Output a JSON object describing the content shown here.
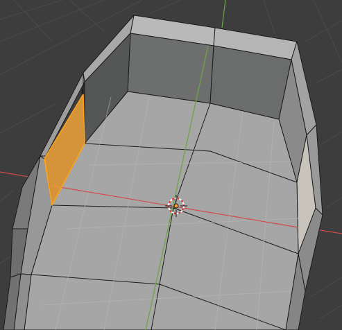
{
  "app": "3D viewport",
  "viewport": {
    "mode": "edit-mode",
    "select_mode": "face",
    "selected_face_color": "#f0a33a",
    "selected_edge_color": "#ffa31a",
    "background_color": "#3d3d3d",
    "grid_color": "#4a4a4a",
    "x_axis_color": "#d24b4b",
    "y_axis_color": "#6ea34a",
    "cursor_icon": "3d-cursor-icon",
    "origin_icon": "object-origin-icon"
  }
}
